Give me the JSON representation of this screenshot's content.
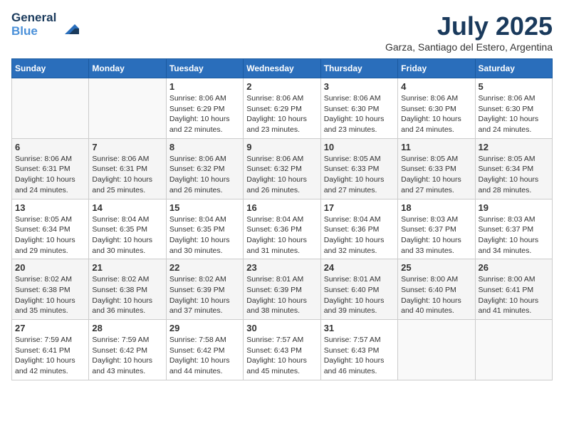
{
  "logo": {
    "line1": "General",
    "line2": "Blue"
  },
  "title": "July 2025",
  "subtitle": "Garza, Santiago del Estero, Argentina",
  "weekdays": [
    "Sunday",
    "Monday",
    "Tuesday",
    "Wednesday",
    "Thursday",
    "Friday",
    "Saturday"
  ],
  "weeks": [
    [
      {
        "day": "",
        "detail": ""
      },
      {
        "day": "",
        "detail": ""
      },
      {
        "day": "1",
        "detail": "Sunrise: 8:06 AM\nSunset: 6:29 PM\nDaylight: 10 hours\nand 22 minutes."
      },
      {
        "day": "2",
        "detail": "Sunrise: 8:06 AM\nSunset: 6:29 PM\nDaylight: 10 hours\nand 23 minutes."
      },
      {
        "day": "3",
        "detail": "Sunrise: 8:06 AM\nSunset: 6:30 PM\nDaylight: 10 hours\nand 23 minutes."
      },
      {
        "day": "4",
        "detail": "Sunrise: 8:06 AM\nSunset: 6:30 PM\nDaylight: 10 hours\nand 24 minutes."
      },
      {
        "day": "5",
        "detail": "Sunrise: 8:06 AM\nSunset: 6:30 PM\nDaylight: 10 hours\nand 24 minutes."
      }
    ],
    [
      {
        "day": "6",
        "detail": "Sunrise: 8:06 AM\nSunset: 6:31 PM\nDaylight: 10 hours\nand 24 minutes."
      },
      {
        "day": "7",
        "detail": "Sunrise: 8:06 AM\nSunset: 6:31 PM\nDaylight: 10 hours\nand 25 minutes."
      },
      {
        "day": "8",
        "detail": "Sunrise: 8:06 AM\nSunset: 6:32 PM\nDaylight: 10 hours\nand 26 minutes."
      },
      {
        "day": "9",
        "detail": "Sunrise: 8:06 AM\nSunset: 6:32 PM\nDaylight: 10 hours\nand 26 minutes."
      },
      {
        "day": "10",
        "detail": "Sunrise: 8:05 AM\nSunset: 6:33 PM\nDaylight: 10 hours\nand 27 minutes."
      },
      {
        "day": "11",
        "detail": "Sunrise: 8:05 AM\nSunset: 6:33 PM\nDaylight: 10 hours\nand 27 minutes."
      },
      {
        "day": "12",
        "detail": "Sunrise: 8:05 AM\nSunset: 6:34 PM\nDaylight: 10 hours\nand 28 minutes."
      }
    ],
    [
      {
        "day": "13",
        "detail": "Sunrise: 8:05 AM\nSunset: 6:34 PM\nDaylight: 10 hours\nand 29 minutes."
      },
      {
        "day": "14",
        "detail": "Sunrise: 8:04 AM\nSunset: 6:35 PM\nDaylight: 10 hours\nand 30 minutes."
      },
      {
        "day": "15",
        "detail": "Sunrise: 8:04 AM\nSunset: 6:35 PM\nDaylight: 10 hours\nand 30 minutes."
      },
      {
        "day": "16",
        "detail": "Sunrise: 8:04 AM\nSunset: 6:36 PM\nDaylight: 10 hours\nand 31 minutes."
      },
      {
        "day": "17",
        "detail": "Sunrise: 8:04 AM\nSunset: 6:36 PM\nDaylight: 10 hours\nand 32 minutes."
      },
      {
        "day": "18",
        "detail": "Sunrise: 8:03 AM\nSunset: 6:37 PM\nDaylight: 10 hours\nand 33 minutes."
      },
      {
        "day": "19",
        "detail": "Sunrise: 8:03 AM\nSunset: 6:37 PM\nDaylight: 10 hours\nand 34 minutes."
      }
    ],
    [
      {
        "day": "20",
        "detail": "Sunrise: 8:02 AM\nSunset: 6:38 PM\nDaylight: 10 hours\nand 35 minutes."
      },
      {
        "day": "21",
        "detail": "Sunrise: 8:02 AM\nSunset: 6:38 PM\nDaylight: 10 hours\nand 36 minutes."
      },
      {
        "day": "22",
        "detail": "Sunrise: 8:02 AM\nSunset: 6:39 PM\nDaylight: 10 hours\nand 37 minutes."
      },
      {
        "day": "23",
        "detail": "Sunrise: 8:01 AM\nSunset: 6:39 PM\nDaylight: 10 hours\nand 38 minutes."
      },
      {
        "day": "24",
        "detail": "Sunrise: 8:01 AM\nSunset: 6:40 PM\nDaylight: 10 hours\nand 39 minutes."
      },
      {
        "day": "25",
        "detail": "Sunrise: 8:00 AM\nSunset: 6:40 PM\nDaylight: 10 hours\nand 40 minutes."
      },
      {
        "day": "26",
        "detail": "Sunrise: 8:00 AM\nSunset: 6:41 PM\nDaylight: 10 hours\nand 41 minutes."
      }
    ],
    [
      {
        "day": "27",
        "detail": "Sunrise: 7:59 AM\nSunset: 6:41 PM\nDaylight: 10 hours\nand 42 minutes."
      },
      {
        "day": "28",
        "detail": "Sunrise: 7:59 AM\nSunset: 6:42 PM\nDaylight: 10 hours\nand 43 minutes."
      },
      {
        "day": "29",
        "detail": "Sunrise: 7:58 AM\nSunset: 6:42 PM\nDaylight: 10 hours\nand 44 minutes."
      },
      {
        "day": "30",
        "detail": "Sunrise: 7:57 AM\nSunset: 6:43 PM\nDaylight: 10 hours\nand 45 minutes."
      },
      {
        "day": "31",
        "detail": "Sunrise: 7:57 AM\nSunset: 6:43 PM\nDaylight: 10 hours\nand 46 minutes."
      },
      {
        "day": "",
        "detail": ""
      },
      {
        "day": "",
        "detail": ""
      }
    ]
  ]
}
